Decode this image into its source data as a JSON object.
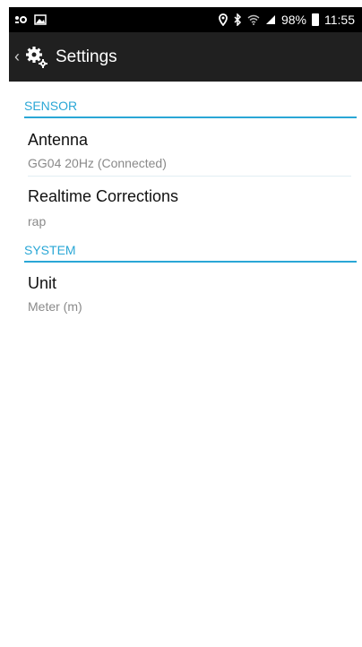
{
  "status_bar": {
    "battery": "98%",
    "time": "11:55"
  },
  "app_bar": {
    "title": "Settings"
  },
  "sections": [
    {
      "header": "SENSOR",
      "items": [
        {
          "title": "Antenna",
          "summary": "GG04 20Hz (Connected)"
        },
        {
          "title": "Realtime Corrections",
          "summary": "rap"
        }
      ]
    },
    {
      "header": "SYSTEM",
      "items": [
        {
          "title": "Unit",
          "summary": "Meter (m)"
        }
      ]
    }
  ],
  "colors": {
    "accent": "#2aa7d6",
    "app_bar": "#202020",
    "status_bar": "#000000"
  }
}
